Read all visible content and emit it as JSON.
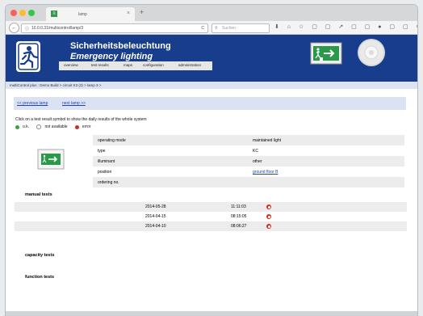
{
  "browser": {
    "tab_title": "lamp",
    "tab_close": "×",
    "new_tab": "+",
    "back": "←",
    "url": "10.0.0.31/multicontrol/lamp/3",
    "reload": "C",
    "search_placeholder": "Suchen",
    "toolbar_icons": "⬇ ⌂ ☆ ▢ ▢ ↗ ▢ ▢ ● ▢ ▢ ≡"
  },
  "app": {
    "title_de": "Sicherheitsbeleuchtung",
    "title_en": "Emergency lighting",
    "menu": [
      "overview",
      "test results",
      "maps",
      "configuration",
      "administration"
    ],
    "breadcrumb": "multiControl plus : Demo Build > circuit K3 (3) > lamp 3 >",
    "prev_lamp": "<< previous lamp",
    "next_lamp": "next lamp >>",
    "instruction": "Click on a test result symbol to show the daily results of the whole system",
    "legend": {
      "ok": "o.k.",
      "not_available": "not available",
      "error": "error"
    },
    "colors": {
      "ok": "#3aa33b",
      "not_available": "#ffffff",
      "error": "#d52b1e",
      "header": "#183d8c"
    }
  },
  "properties": [
    {
      "label": "operating mode",
      "value": "maintained light",
      "is_link": false
    },
    {
      "label": "type",
      "value": "KC",
      "is_link": false
    },
    {
      "label": "illuminant",
      "value": "other",
      "is_link": false
    },
    {
      "label": "position",
      "value": "ground floor B",
      "is_link": true
    },
    {
      "label": "ordering no.",
      "value": "",
      "is_link": false
    }
  ],
  "manual_tests": {
    "heading": "manual tests",
    "rows": [
      {
        "date": "2014-05-28",
        "time": "11:11:03",
        "result": "error"
      },
      {
        "date": "2014-04-15",
        "time": "08:15:05",
        "result": "error"
      },
      {
        "date": "2014-04-10",
        "time": "08:06:27",
        "result": "error"
      }
    ]
  },
  "capacity_tests": {
    "heading": "capacity tests"
  },
  "function_tests": {
    "heading": "function tests"
  }
}
